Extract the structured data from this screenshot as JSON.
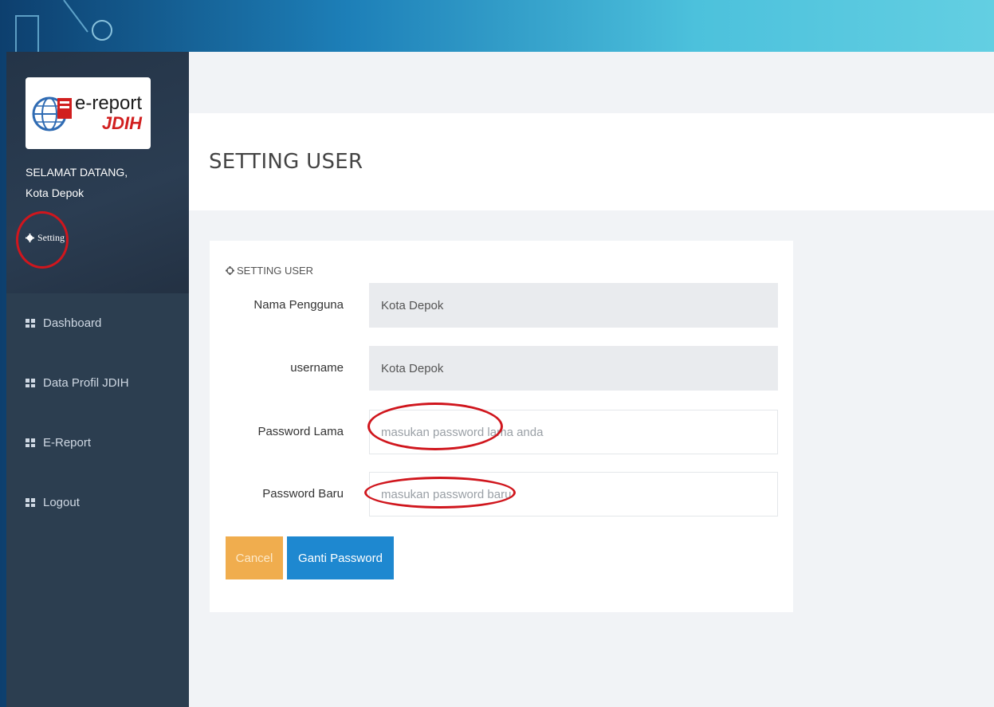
{
  "sidebar": {
    "logo": {
      "line1": "e-report",
      "line2": "JDIH"
    },
    "welcome_line1": "SELAMAT DATANG,",
    "welcome_line2": "Kota Depok",
    "setting_label": "Setting",
    "items": [
      {
        "label": "Dashboard",
        "icon": "grid-icon"
      },
      {
        "label": "Data Profil JDIH",
        "icon": "grid-icon"
      },
      {
        "label": "E-Report",
        "icon": "grid-icon"
      },
      {
        "label": "Logout",
        "icon": "grid-icon"
      }
    ]
  },
  "header": {
    "title": "SETTING USER"
  },
  "card": {
    "title": "SETTING USER",
    "fields": [
      {
        "label": "Nama Pengguna",
        "value": "Kota Depok",
        "placeholder": ""
      },
      {
        "label": "username",
        "value": "Kota Depok",
        "placeholder": ""
      },
      {
        "label": "Password Lama",
        "value": "",
        "placeholder": "masukan password lama anda"
      },
      {
        "label": "Password Baru",
        "value": "",
        "placeholder": "masukan password baru"
      }
    ],
    "cancel_label": "Cancel",
    "submit_label": "Ganti Password"
  },
  "colors": {
    "sidebar_bg": "#2c3e50",
    "cancel_button": "#f0ad4e",
    "submit_button": "#1e88d0",
    "annotation_red": "#d0161d"
  }
}
